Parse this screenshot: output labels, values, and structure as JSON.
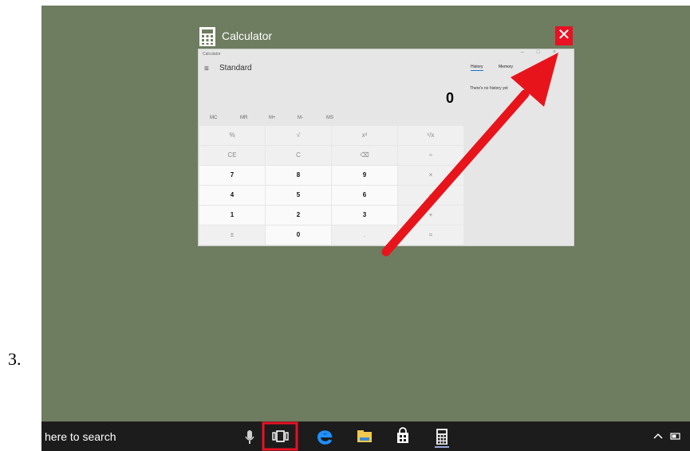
{
  "step": {
    "number": "3."
  },
  "task_view": {
    "title": "Calculator",
    "close_glyph": "✕",
    "app_icon": "calculator-icon"
  },
  "calculator": {
    "titlebar_text": "Calculator",
    "mode": "Standard",
    "display": "0",
    "memory_buttons": [
      "MC",
      "MR",
      "M+",
      "M-",
      "MS"
    ],
    "keys": [
      [
        "%",
        "√",
        "x²",
        "¹/x"
      ],
      [
        "CE",
        "C",
        "⌫",
        "÷"
      ],
      [
        "7",
        "8",
        "9",
        "×"
      ],
      [
        "4",
        "5",
        "6",
        "−"
      ],
      [
        "1",
        "2",
        "3",
        "+"
      ],
      [
        "±",
        "0",
        ".",
        "="
      ]
    ],
    "history_tab": "History",
    "memory_tab": "Memory",
    "history_empty": "There's no history yet"
  },
  "taskbar": {
    "search_text": "here to search",
    "icons": [
      "microphone-icon",
      "task-view-icon",
      "edge-icon",
      "file-explorer-icon",
      "store-icon",
      "calculator-icon"
    ],
    "highlight_color": "#e81123"
  },
  "annotation": {
    "arrow_color": "#e8141c"
  }
}
